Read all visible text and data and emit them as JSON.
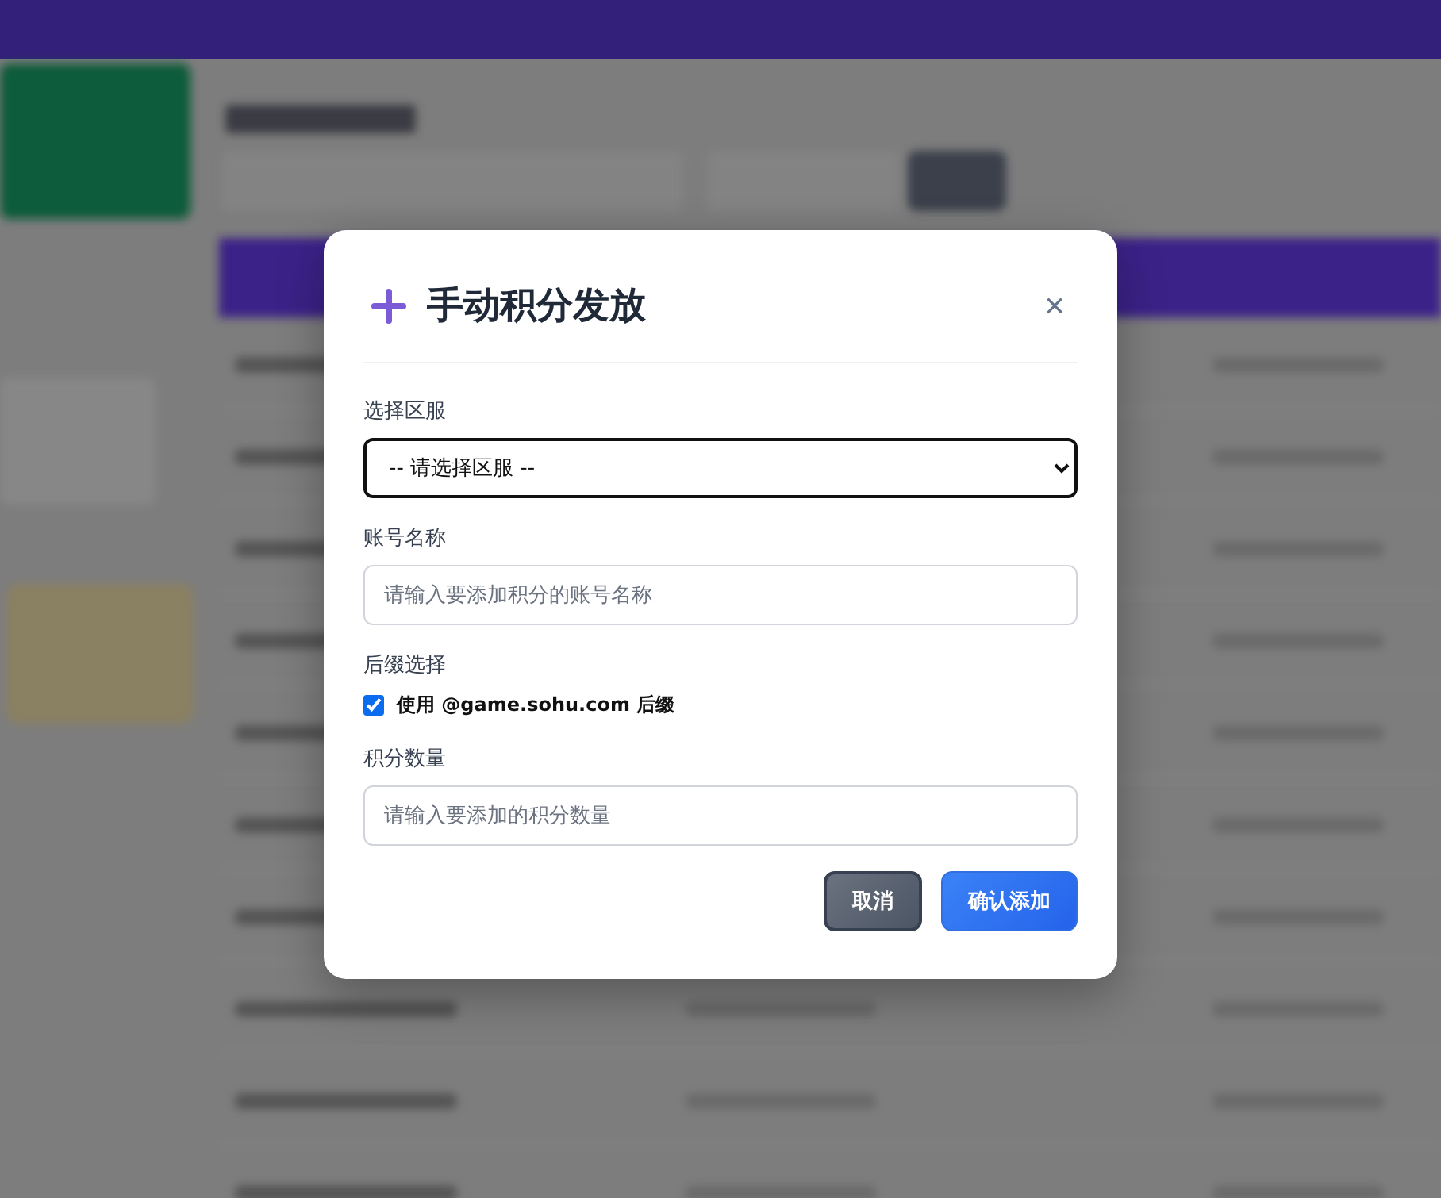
{
  "dialog": {
    "title": "手动积分发放",
    "close": "×",
    "fields": [
      {
        "kind": "select",
        "label": "选择区服",
        "value": "-- 请选择区服 --"
      },
      {
        "kind": "text",
        "label": "账号名称",
        "placeholder": "请输入要添加积分的账号名称"
      },
      {
        "kind": "checkbox",
        "label": "后缀选择",
        "option": "使用 @game.sohu.com 后缀",
        "checked": true
      },
      {
        "kind": "text",
        "label": "积分数量",
        "placeholder": "请输入要添加的积分数量"
      }
    ],
    "buttons": [
      {
        "label": "取消",
        "kind": "secondary"
      },
      {
        "label": "确认添加",
        "kind": "primary"
      }
    ]
  }
}
